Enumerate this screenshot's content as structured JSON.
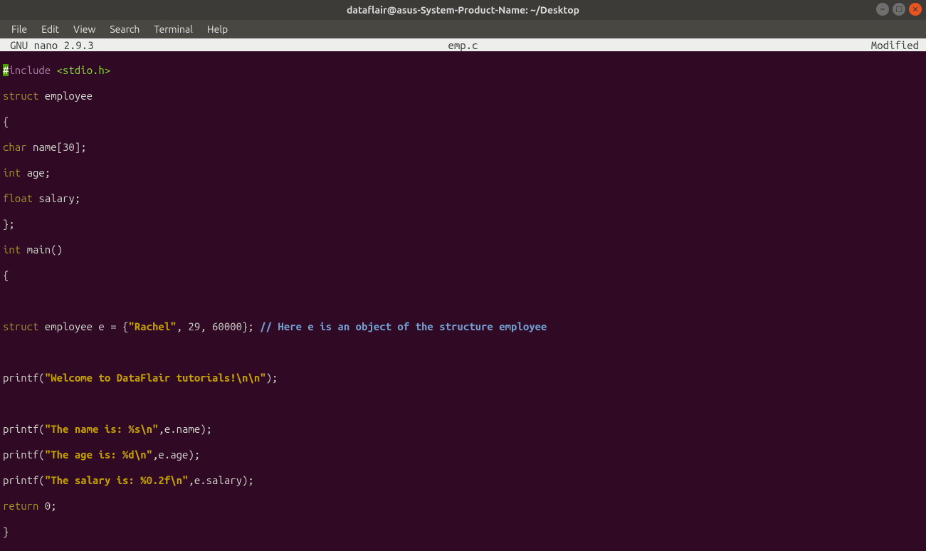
{
  "window": {
    "title": "dataflair@asus-System-Product-Name: ~/Desktop"
  },
  "menu": {
    "file": "File",
    "edit": "Edit",
    "view": "View",
    "search": "Search",
    "terminal": "Terminal",
    "help": "Help"
  },
  "statusbar": {
    "left": "GNU nano 2.9.3",
    "center": "emp.c",
    "right": "Modified"
  },
  "code": {
    "l1_hash": "#",
    "l1_include": "include ",
    "l1_header": "<stdio.h>",
    "l2_struct": "struct",
    "l2_rest": " employee",
    "l3": "{",
    "l4_type": "char",
    "l4_rest": " name[30];",
    "l5_type": "int",
    "l5_rest": " age;",
    "l6_type": "float",
    "l6_rest": " salary;",
    "l7": "};",
    "l8_type": "int",
    "l8_rest": " main()",
    "l9": "{",
    "l11_struct": "struct",
    "l11_mid": " employee e = {",
    "l11_str": "\"Rachel\"",
    "l11_vals": ", 29, 60000}; ",
    "l11_comm": "// Here e is an object of the structure employee",
    "l13_a": "printf(",
    "l13_str": "\"Welcome to DataFlair tutorials!\\n\\n\"",
    "l13_b": ");",
    "l15_a": "printf(",
    "l15_str": "\"The name is: %s\\n\"",
    "l15_b": ",e.name);",
    "l16_a": "printf(",
    "l16_str": "\"The age is: %d\\n\"",
    "l16_b": ",e.age);",
    "l17_a": "printf(",
    "l17_str": "\"The salary is: %0.2f\\n\"",
    "l17_b": ",e.salary);",
    "l18_ret": "return",
    "l18_b": " 0;",
    "l19": "}"
  }
}
